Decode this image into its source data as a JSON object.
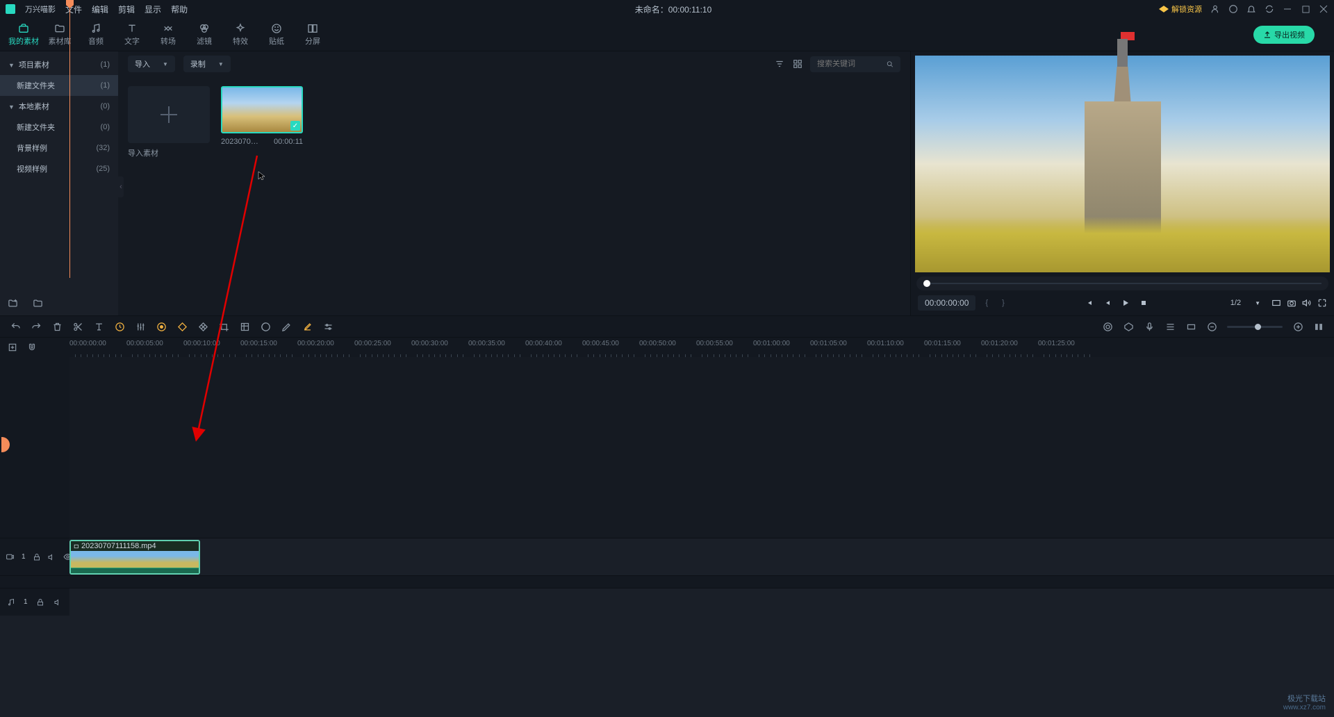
{
  "titlebar": {
    "app_name": "万兴喵影",
    "menu": {
      "file": "文件",
      "edit": "编辑",
      "cut": "剪辑",
      "display": "显示",
      "help": "帮助"
    },
    "project_title": "未命名：00:00:11:10",
    "unlock": "解锁资源"
  },
  "tabs": {
    "my_media": "我的素材",
    "media_lib": "素材库",
    "audio": "音频",
    "text": "文字",
    "transition": "转场",
    "filter": "滤镜",
    "effect": "特效",
    "sticker": "贴纸",
    "split": "分屏",
    "export": "导出视频"
  },
  "sidebar": {
    "project": {
      "label": "项目素材",
      "count": "(1)"
    },
    "new_folder1": {
      "label": "新建文件夹",
      "count": "(1)"
    },
    "local": {
      "label": "本地素材",
      "count": "(0)"
    },
    "new_folder2": {
      "label": "新建文件夹",
      "count": "(0)"
    },
    "bg_sample": {
      "label": "背景样例",
      "count": "(32)"
    },
    "video_sample": {
      "label": "视频样例",
      "count": "(25)"
    }
  },
  "media": {
    "import_dd": "导入",
    "record_dd": "录制",
    "search_placeholder": "搜索关键词",
    "import_card": "导入素材",
    "thumb_name": "2023070…",
    "thumb_dur": "00:00:11"
  },
  "preview": {
    "time": "00:00:00:00",
    "zoom": "1/2"
  },
  "timeline": {
    "ticks": [
      "00:00:00:00",
      "00:00:05:00",
      "00:00:10:00",
      "00:00:15:00",
      "00:00:20:00",
      "00:00:25:00",
      "00:00:30:00",
      "00:00:35:00",
      "00:00:40:00",
      "00:00:45:00",
      "00:00:50:00",
      "00:00:55:00",
      "00:01:00:00",
      "00:01:05:00",
      "00:01:10:00",
      "00:01:15:00",
      "00:01:20:00",
      "00:01:25:00"
    ],
    "clip_name": "20230707111158.mp4",
    "video_track": "1",
    "audio_track": "1"
  },
  "watermark": {
    "l1": "极光下载站",
    "l2": "www.xz7.com"
  },
  "colors": {
    "accent": "#28d9c0",
    "playhead": "#f58c5a"
  }
}
